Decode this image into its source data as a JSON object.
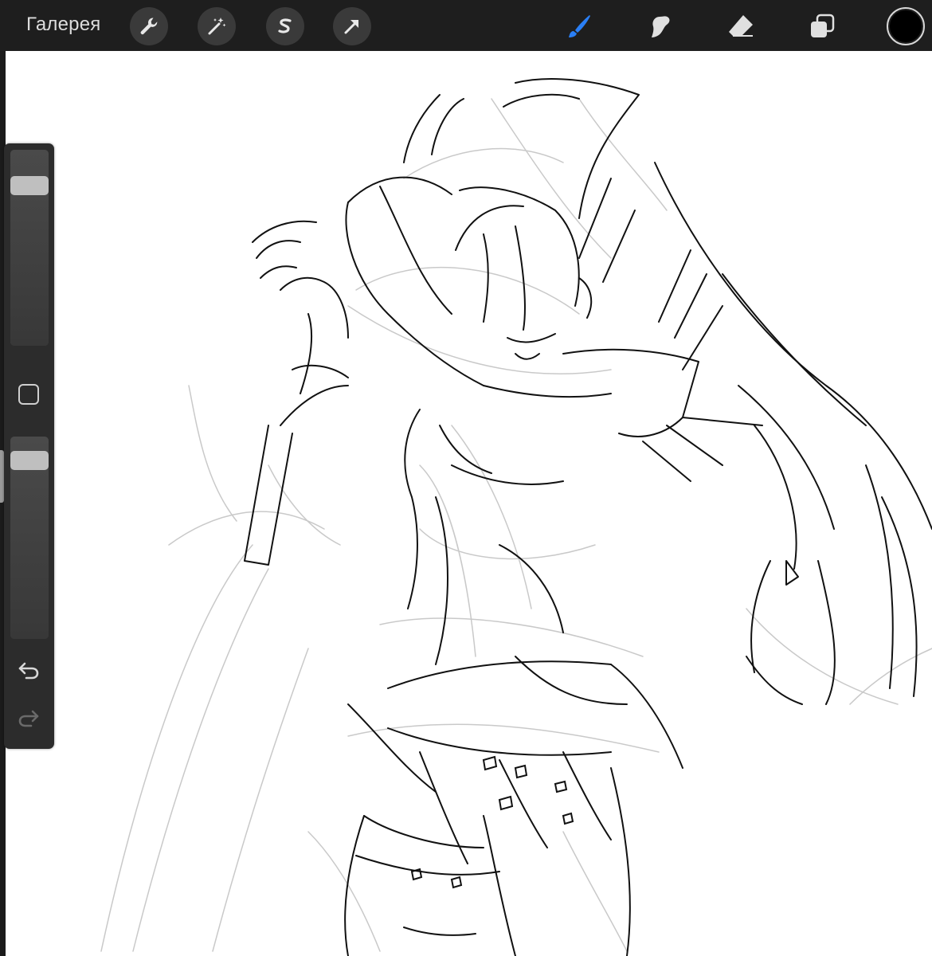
{
  "toolbar": {
    "gallery_label": "Галерея",
    "left_tools": [
      {
        "name": "actions",
        "icon": "wrench-icon"
      },
      {
        "name": "adjustments",
        "icon": "magic-wand-icon"
      },
      {
        "name": "selection",
        "icon": "selection-s-icon"
      },
      {
        "name": "transform",
        "icon": "arrow-cursor-icon"
      }
    ],
    "right_tools": [
      {
        "name": "brush",
        "icon": "brush-icon",
        "active": true
      },
      {
        "name": "smudge",
        "icon": "smudge-icon",
        "active": false
      },
      {
        "name": "eraser",
        "icon": "eraser-icon",
        "active": false
      },
      {
        "name": "layers",
        "icon": "layers-icon",
        "active": false
      }
    ],
    "active_color": "#000000",
    "accent_color": "#2a7ff5"
  },
  "sidebar": {
    "brush_size_level": 0.85,
    "opacity_level": 0.92,
    "modify_button_icon": "square-outline-icon",
    "undo_icon": "undo-arrow-icon",
    "redo_icon": "redo-arrow-icon"
  },
  "canvas": {
    "background": "#ffffff",
    "content": "line-art-sketch"
  }
}
